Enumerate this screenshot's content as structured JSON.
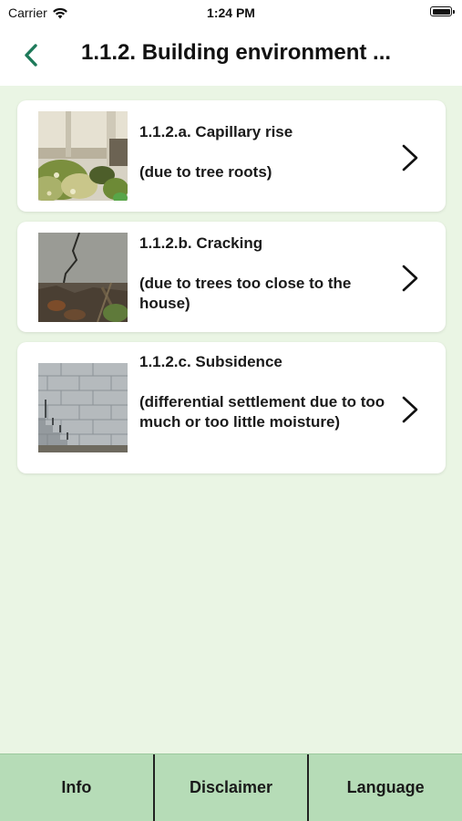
{
  "status_bar": {
    "carrier": "Carrier",
    "time": "1:24 PM",
    "icons": [
      "wifi-icon",
      "battery-icon"
    ]
  },
  "nav": {
    "title": "1.1.2. Building environment ...",
    "back_icon": "chevron-left-icon",
    "accent_color": "#1e7a5a"
  },
  "items": [
    {
      "title": "1.1.2.a. Capillary rise",
      "subtitle": "(due to tree roots)",
      "thumb": "capillary-rise-photo"
    },
    {
      "title": "1.1.2.b. Cracking",
      "subtitle": "(due to trees too close to the house)",
      "thumb": "cracking-photo"
    },
    {
      "title": "1.1.2.c. Subsidence",
      "subtitle": "(differential settlement due to too much or too little moisture)",
      "thumb": "subsidence-photo"
    }
  ],
  "tabs": [
    {
      "label": "Info"
    },
    {
      "label": "Disclaimer"
    },
    {
      "label": "Language"
    }
  ],
  "colors": {
    "background": "#eaf5e4",
    "tab_bar": "#b6dcb7",
    "card": "#ffffff"
  }
}
